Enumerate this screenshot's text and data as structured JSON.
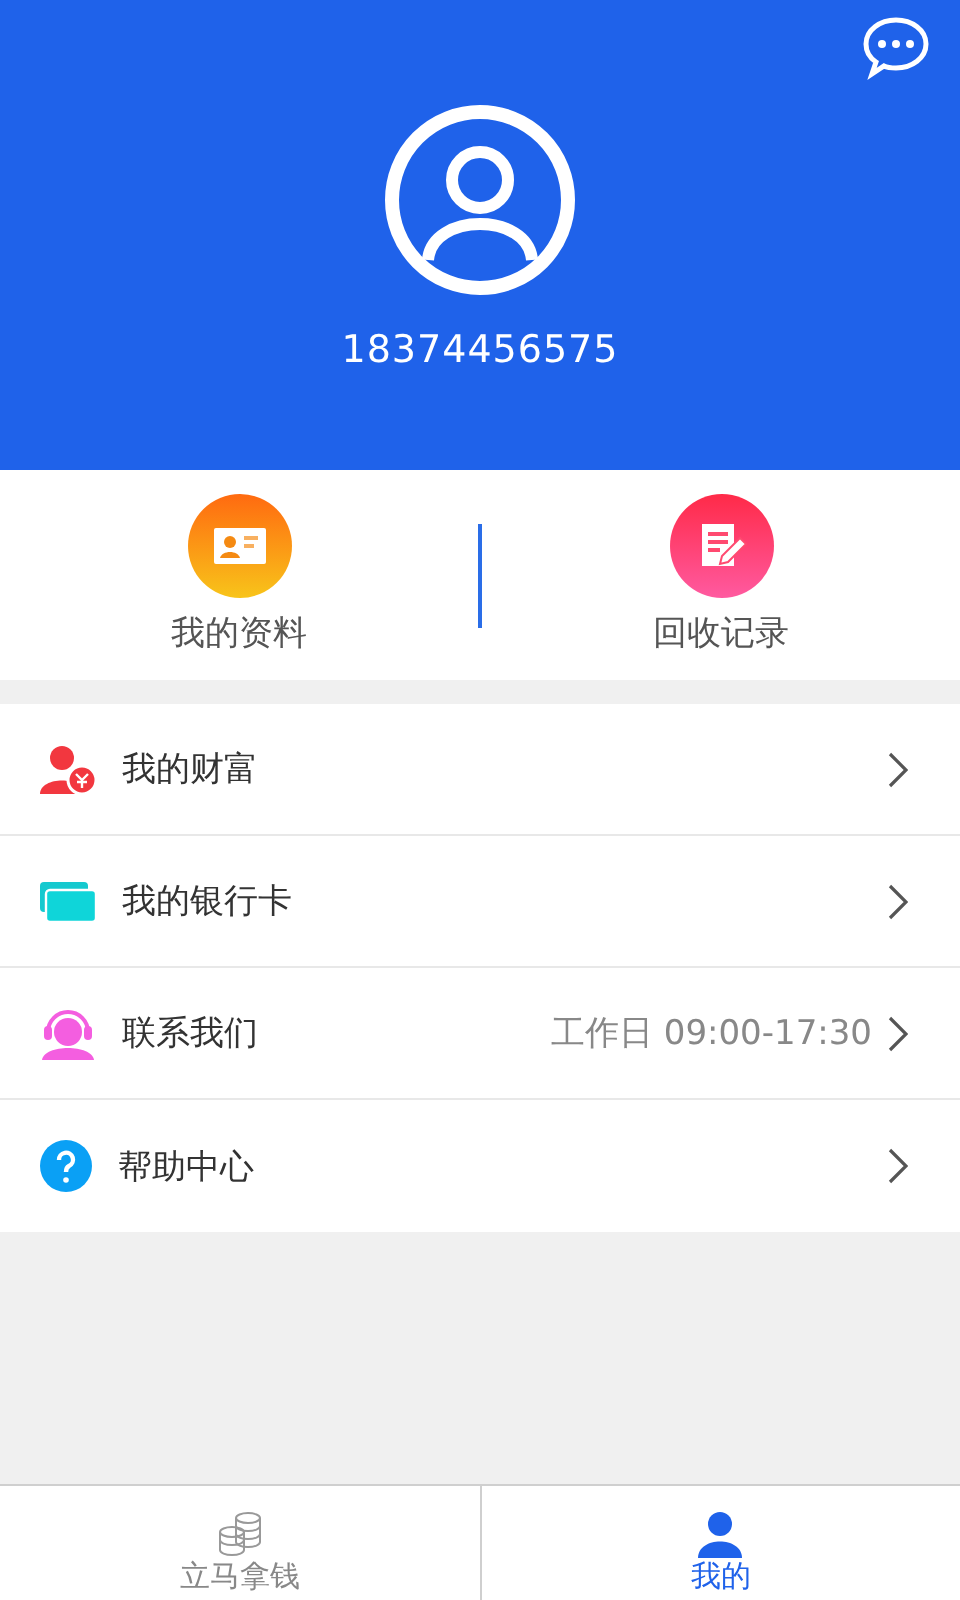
{
  "header": {
    "phone": "18374456575"
  },
  "shortcuts": [
    {
      "kind": "profile",
      "label": "我的资料"
    },
    {
      "kind": "records",
      "label": "回收记录"
    }
  ],
  "menu": [
    {
      "kind": "wealth",
      "label": "我的财富"
    },
    {
      "kind": "card",
      "label": "我的银行卡"
    },
    {
      "kind": "service",
      "label": "联系我们",
      "detail": "工作日 09:00-17:30"
    },
    {
      "kind": "help",
      "label": "帮助中心"
    }
  ],
  "tabs": [
    {
      "kind": "coins",
      "label": "立马拿钱",
      "selected": false
    },
    {
      "kind": "user",
      "label": "我的",
      "selected": true
    }
  ]
}
